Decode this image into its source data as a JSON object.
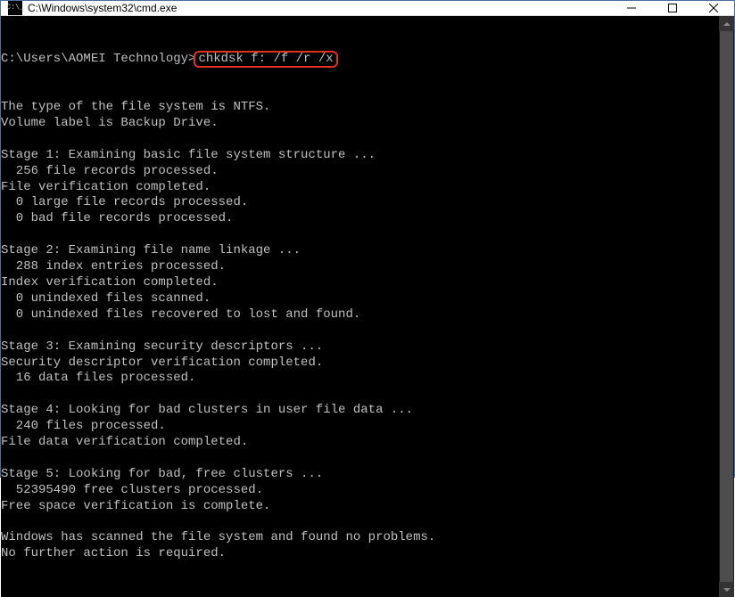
{
  "window": {
    "title": "C:\\Windows\\system32\\cmd.exe",
    "icon_label": "C:\\_"
  },
  "terminal": {
    "prompt": "C:\\Users\\AOMEI Technology>",
    "command": "chkdsk f: /f /r /x",
    "lines": [
      "The type of the file system is NTFS.",
      "Volume label is Backup Drive.",
      "",
      "Stage 1: Examining basic file system structure ...",
      "  256 file records processed.",
      "File verification completed.",
      "  0 large file records processed.",
      "  0 bad file records processed.",
      "",
      "Stage 2: Examining file name linkage ...",
      "  288 index entries processed.",
      "Index verification completed.",
      "  0 unindexed files scanned.",
      "  0 unindexed files recovered to lost and found.",
      "",
      "Stage 3: Examining security descriptors ...",
      "Security descriptor verification completed.",
      "  16 data files processed.",
      "",
      "Stage 4: Looking for bad clusters in user file data ...",
      "  240 files processed.",
      "File data verification completed.",
      "",
      "Stage 5: Looking for bad, free clusters ...",
      "  52395490 free clusters processed.",
      "Free space verification is complete.",
      "",
      "Windows has scanned the file system and found no problems.",
      "No further action is required."
    ]
  }
}
